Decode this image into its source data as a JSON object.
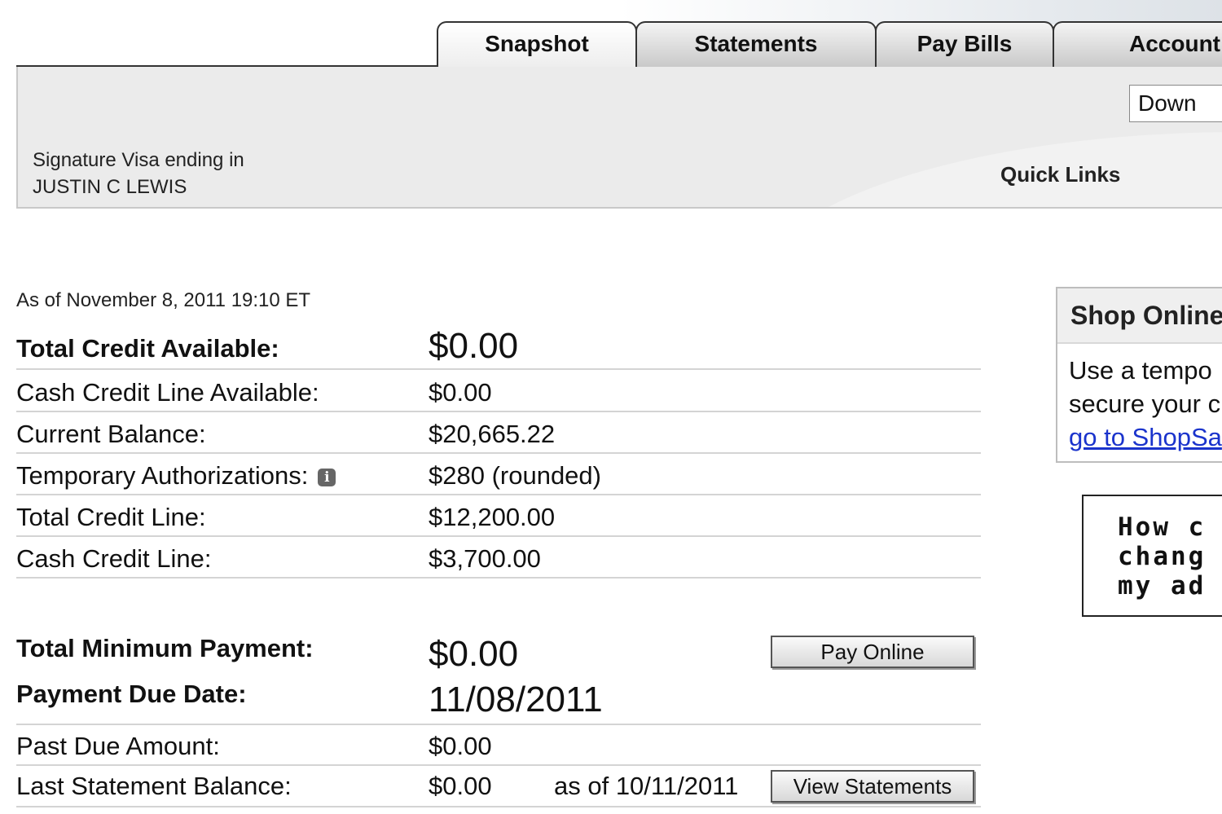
{
  "tabs": [
    {
      "label": "Snapshot",
      "active": true
    },
    {
      "label": "Statements",
      "active": false
    },
    {
      "label": "Pay Bills",
      "active": false
    },
    {
      "label": "Account",
      "active": false
    }
  ],
  "account": {
    "card_line": "Signature Visa ending in",
    "holder_name": "JUSTIN C LEWIS"
  },
  "quick_links": {
    "label": "Quick Links",
    "selected": "Down"
  },
  "summary": {
    "as_of": "As of November 8, 2011 19:10 ET",
    "rows": [
      {
        "label": "Total Credit Available:",
        "value": "$0.00"
      },
      {
        "label": "Cash Credit Line Available:",
        "value": "$0.00"
      },
      {
        "label": "Current Balance:",
        "value": "$20,665.22"
      },
      {
        "label": "Temporary Authorizations:",
        "value": "$280 (rounded)"
      },
      {
        "label": "Total Credit Line:",
        "value": "$12,200.00"
      },
      {
        "label": "Cash Credit Line:",
        "value": "$3,700.00"
      }
    ]
  },
  "payment": {
    "min_label": "Total Minimum Payment:",
    "min_value": "$0.00",
    "due_label": "Payment Due Date:",
    "due_value": "11/08/2011",
    "past_due_label": "Past Due Amount:",
    "past_due_value": "$0.00",
    "last_stmt_label": "Last Statement Balance:",
    "last_stmt_value": "$0.00",
    "last_stmt_date": "as of 10/11/2011",
    "pay_online_label": "Pay Online",
    "view_statements_label": "View Statements"
  },
  "shop_online": {
    "title": "Shop Online",
    "line1": "Use a tempo",
    "line2": "secure your c",
    "link": "go to ShopSa"
  },
  "faq": {
    "line1": "How c",
    "line2": "chang",
    "line3": "my ad"
  },
  "icons": {
    "info": "info-icon"
  }
}
